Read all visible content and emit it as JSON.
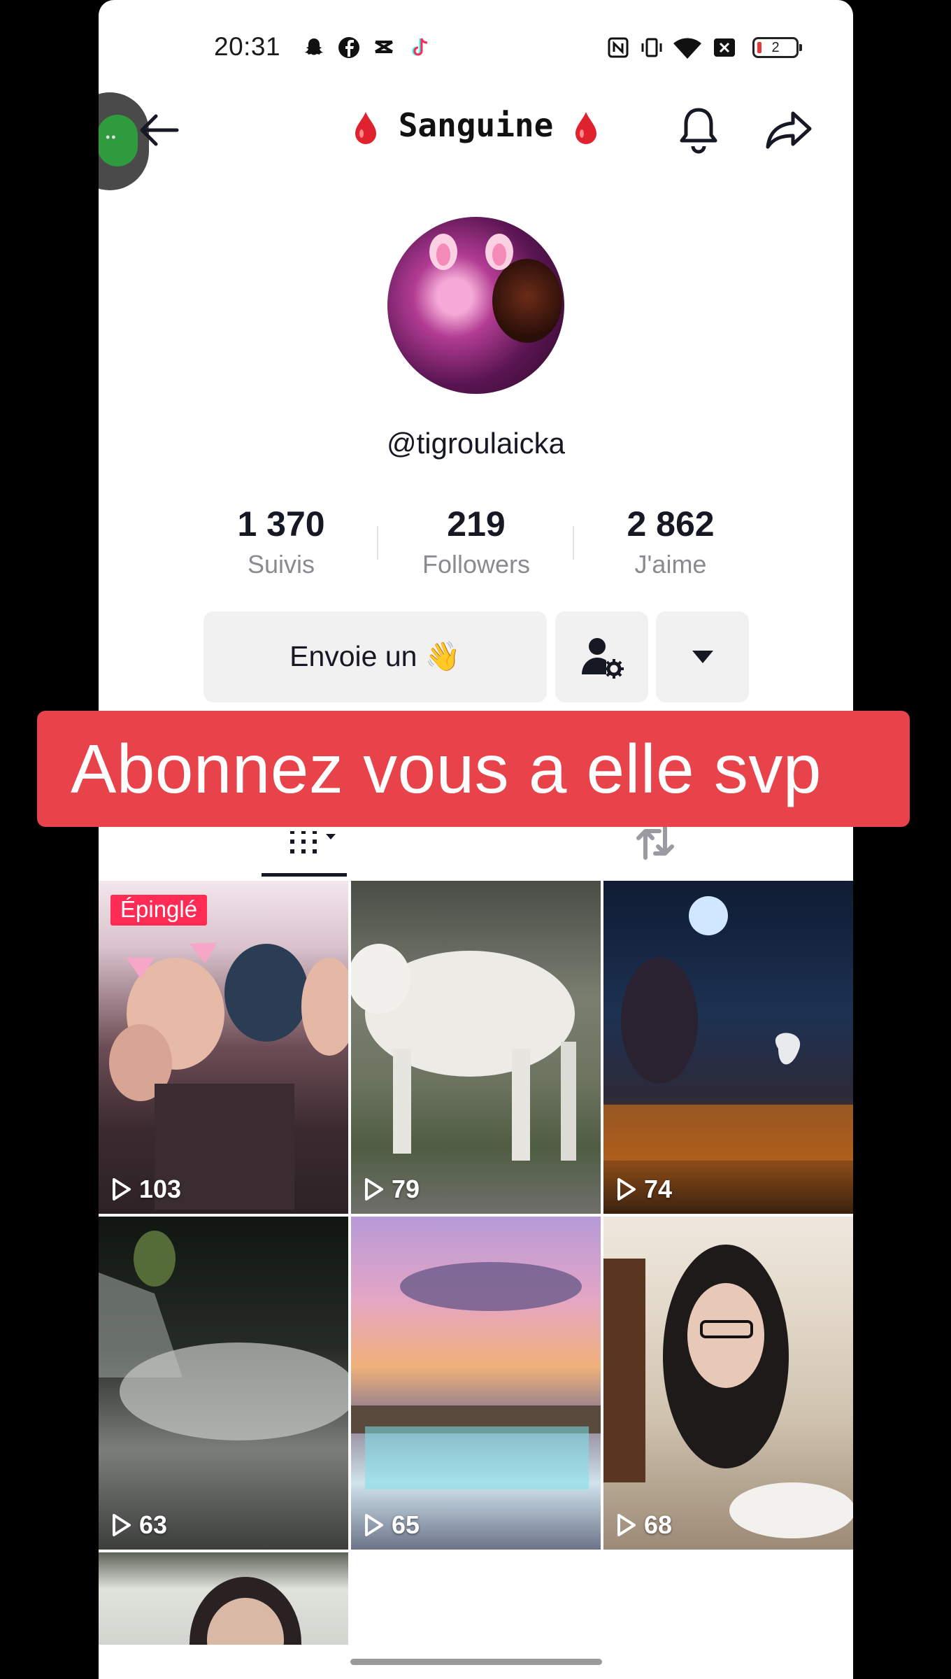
{
  "status_bar": {
    "time": "20:31",
    "notification_icons": [
      "snapchat-icon",
      "facebook-icon",
      "capcut-icon",
      "tiktok-icon"
    ],
    "system_icons": [
      "nfc-icon",
      "vibrate-icon",
      "wifi-icon",
      "no-sim-icon",
      "battery-icon"
    ],
    "battery": "2"
  },
  "header": {
    "title": "Sanguine",
    "title_decoration": "blood-drop-icon",
    "back_icon": "arrow-left-icon",
    "bell_icon": "bell-icon",
    "share_icon": "share-icon"
  },
  "profile": {
    "username": "@tigroulaicka",
    "stats": [
      {
        "value": "1 370",
        "label": "Suivis"
      },
      {
        "value": "219",
        "label": "Followers"
      },
      {
        "value": "2 862",
        "label": "J'aime"
      }
    ],
    "message_button": "Envoie un 👋",
    "add_friend_icon": "user-settings-icon",
    "more_icon": "caret-down-icon"
  },
  "caption": "Abonnez vous a elle svp",
  "tabs": [
    {
      "icon": "grid-icon",
      "active": true
    },
    {
      "icon": "repost-icon",
      "active": false
    }
  ],
  "videos": [
    {
      "views": "103",
      "pinned": true,
      "pinned_label": "Épinglé"
    },
    {
      "views": "79"
    },
    {
      "views": "74"
    },
    {
      "views": "63"
    },
    {
      "views": "65"
    },
    {
      "views": "68"
    },
    {
      "views": ""
    }
  ],
  "colors": {
    "accent": "#fe2c55",
    "caption_bg": "#e8434a",
    "text": "#161823",
    "muted": "#8a8b91"
  }
}
